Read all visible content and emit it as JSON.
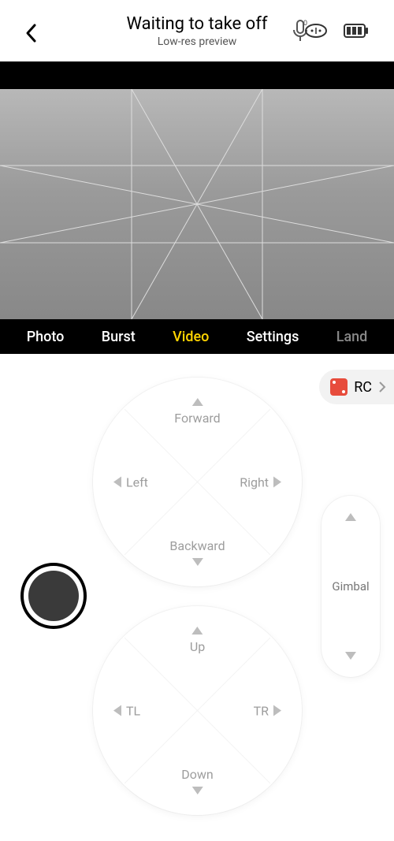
{
  "header": {
    "title": "Waiting to take off",
    "subtitle": "Low-res preview"
  },
  "tabs": {
    "photo": "Photo",
    "burst": "Burst",
    "video": "Video",
    "settings": "Settings",
    "land": "Land"
  },
  "rc": {
    "label": "RC"
  },
  "joystick_top": {
    "up": "Forward",
    "down": "Backward",
    "left": "Left",
    "right": "Right"
  },
  "joystick_bottom": {
    "up": "Up",
    "down": "Down",
    "left": "TL",
    "right": "TR"
  },
  "gimbal": {
    "label": "Gimbal"
  }
}
